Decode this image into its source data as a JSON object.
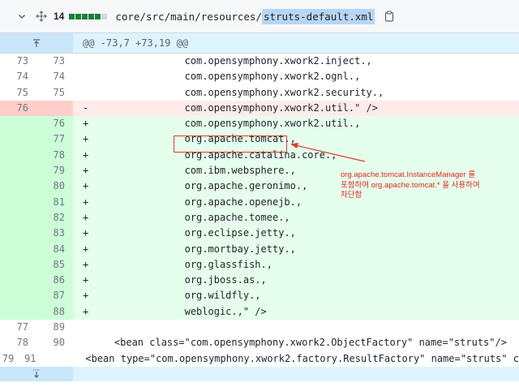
{
  "file_header": {
    "changes_count": "14",
    "path_prefix": "core/src/main/resources/",
    "path_highlight": "struts-default.xml",
    "diffstat": [
      "add",
      "add",
      "add",
      "add",
      "add",
      "neutral"
    ]
  },
  "hunk": {
    "header": "@@ -73,7 +73,19 @@"
  },
  "lines": [
    {
      "type": "ctx",
      "old": "73",
      "new": "73",
      "sign": " ",
      "text": "                com.opensymphony.xwork2.inject.,"
    },
    {
      "type": "ctx",
      "old": "74",
      "new": "74",
      "sign": " ",
      "text": "                com.opensymphony.xwork2.ognl.,"
    },
    {
      "type": "ctx",
      "old": "75",
      "new": "75",
      "sign": " ",
      "text": "                com.opensymphony.xwork2.security.,"
    },
    {
      "type": "del",
      "old": "76",
      "new": "",
      "sign": "-",
      "text": "                com.opensymphony.xwork2.util.\" />"
    },
    {
      "type": "add",
      "old": "",
      "new": "76",
      "sign": "+",
      "text": "                com.opensymphony.xwork2.util.,"
    },
    {
      "type": "add",
      "old": "",
      "new": "77",
      "sign": "+",
      "text": "                org.apache.tomcat.,"
    },
    {
      "type": "add",
      "old": "",
      "new": "78",
      "sign": "+",
      "text": "                org.apache.catalina.core.,"
    },
    {
      "type": "add",
      "old": "",
      "new": "79",
      "sign": "+",
      "text": "                com.ibm.websphere.,"
    },
    {
      "type": "add",
      "old": "",
      "new": "80",
      "sign": "+",
      "text": "                org.apache.geronimo.,"
    },
    {
      "type": "add",
      "old": "",
      "new": "81",
      "sign": "+",
      "text": "                org.apache.openejb.,"
    },
    {
      "type": "add",
      "old": "",
      "new": "82",
      "sign": "+",
      "text": "                org.apache.tomee.,"
    },
    {
      "type": "add",
      "old": "",
      "new": "83",
      "sign": "+",
      "text": "                org.eclipse.jetty.,"
    },
    {
      "type": "add",
      "old": "",
      "new": "84",
      "sign": "+",
      "text": "                org.mortbay.jetty.,"
    },
    {
      "type": "add",
      "old": "",
      "new": "85",
      "sign": "+",
      "text": "                org.glassfish.,"
    },
    {
      "type": "add",
      "old": "",
      "new": "86",
      "sign": "+",
      "text": "                org.jboss.as.,"
    },
    {
      "type": "add",
      "old": "",
      "new": "87",
      "sign": "+",
      "text": "                org.wildfly.,"
    },
    {
      "type": "add",
      "old": "",
      "new": "88",
      "sign": "+",
      "text": "                weblogic.,\" />"
    },
    {
      "type": "ctx",
      "old": "77",
      "new": "89",
      "sign": " ",
      "text": ""
    },
    {
      "type": "ctx",
      "old": "78",
      "new": "90",
      "sign": " ",
      "text": "    <bean class=\"com.opensymphony.xwork2.ObjectFactory\" name=\"struts\"/>"
    },
    {
      "type": "ctx",
      "old": "79",
      "new": "91",
      "sign": " ",
      "text": "    <bean type=\"com.opensymphony.xwork2.factory.ResultFactory\" name=\"struts\" c"
    }
  ],
  "annotation": {
    "line1": "org.apache.tomcat.InstanceManager 를",
    "line2": "포함하여 org.apache.tomcat.* 을 사용하여",
    "line3": "차단함",
    "color": "#e0261b"
  },
  "colors": {
    "add_bg": "#e6ffec",
    "add_ln_bg": "#ccffd8",
    "del_bg": "#ffebe9",
    "del_ln_bg": "#ffcecb",
    "hunk_bg": "#ddf4ff",
    "diffstat_add": "#1a7f37",
    "diffstat_neutral": "#d0d7de"
  },
  "icons": {
    "collapse": "chevron-down-icon",
    "move": "move-icon",
    "copy": "copy-icon",
    "expand_up": "expand-up-icon",
    "expand_down": "expand-down-icon"
  }
}
